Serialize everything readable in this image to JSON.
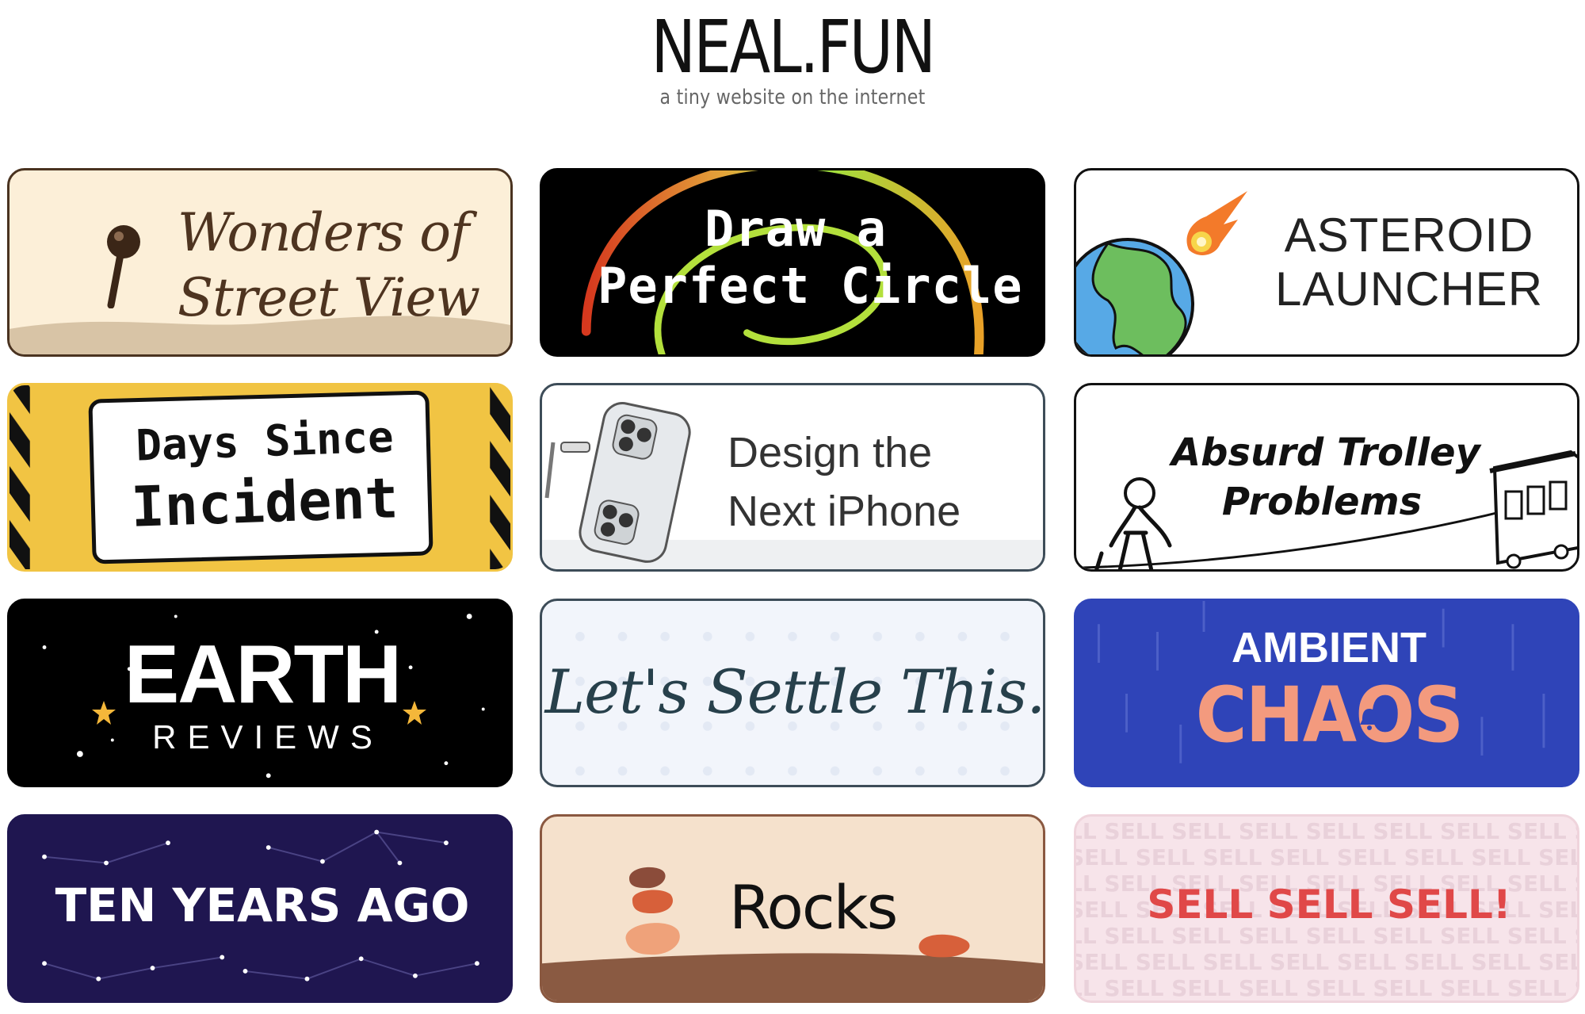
{
  "header": {
    "title": "NEAL.FUN",
    "tagline": "a tiny website on the internet"
  },
  "projects": [
    {
      "id": "street",
      "label": "Wonders of\nStreet View",
      "icons": [
        "map-pin-icon"
      ],
      "bg": "#fcefd8"
    },
    {
      "id": "circle",
      "label": "Draw a\nPerfect Circle",
      "bg": "#000000"
    },
    {
      "id": "asteroid",
      "label": "ASTEROID\nLAUNCHER",
      "icons": [
        "earth-icon",
        "asteroid-icon"
      ],
      "bg": "#ffffff"
    },
    {
      "id": "days",
      "line1": "Days Since",
      "line2": "Incident",
      "bg": "#f1c443"
    },
    {
      "id": "iphone",
      "label": "Design the\nNext iPhone",
      "icons": [
        "iphone-icon"
      ],
      "bg": "#ffffff"
    },
    {
      "id": "trolley",
      "label": "Absurd Trolley\nProblems",
      "icons": [
        "person-icon",
        "trolley-icon"
      ],
      "bg": "#ffffff"
    },
    {
      "id": "earth",
      "title": "EARTH",
      "subtitle": "REVIEWS",
      "icons": [
        "star-icon"
      ],
      "bg": "#000000"
    },
    {
      "id": "settle",
      "label": "Let's Settle This.",
      "bg": "#f2f5fb"
    },
    {
      "id": "ambient",
      "top": "AMBIENT",
      "bottom": "CHAOS",
      "icons": [
        "bell-icon"
      ],
      "bg": "#2f44b8"
    },
    {
      "id": "ten",
      "label": "TEN YEARS AGO",
      "icons": [
        "constellation-icon"
      ],
      "bg": "#1f1650"
    },
    {
      "id": "rocks",
      "label": "Rocks",
      "icons": [
        "rock-stack-icon"
      ],
      "bg": "#f5e1cc"
    },
    {
      "id": "sell",
      "label": "SELL SELL SELL!",
      "bg_word": "SELL",
      "bg": "#f7e4ea"
    }
  ]
}
